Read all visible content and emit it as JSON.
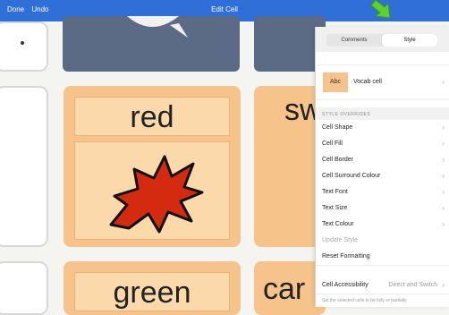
{
  "topbar": {
    "done": "Done",
    "undo": "Undo",
    "title": "Edit Cell"
  },
  "cells": {
    "red_label": "red",
    "green_label": "green",
    "partial_sw": "sw",
    "partial_car": "car"
  },
  "panel": {
    "tabs": {
      "comments": "Comments",
      "style": "Style"
    },
    "preview": {
      "swatch": "Abc",
      "text": "Vocab cell"
    },
    "section": "STYLE OVERRIDES",
    "items": [
      {
        "label": "Cell Shape"
      },
      {
        "label": "Cell Fill"
      },
      {
        "label": "Cell Border"
      },
      {
        "label": "Cell Surround Colour"
      },
      {
        "label": "Text Font"
      },
      {
        "label": "Text Size"
      },
      {
        "label": "Text Colour"
      },
      {
        "label": "Update Style"
      },
      {
        "label": "Reset Formatting"
      }
    ],
    "accessibility": {
      "label": "Cell Accessibility",
      "value": "Direct and Switch"
    },
    "footer": "Set the selected cells to be fully or partially"
  },
  "colors": {
    "topbar": "#2f6fd8",
    "cell_orange": "#f6c48b",
    "cell_slate": "#5b6b85",
    "splat_red": "#d42a10",
    "arrow_green": "#5ed12d"
  }
}
